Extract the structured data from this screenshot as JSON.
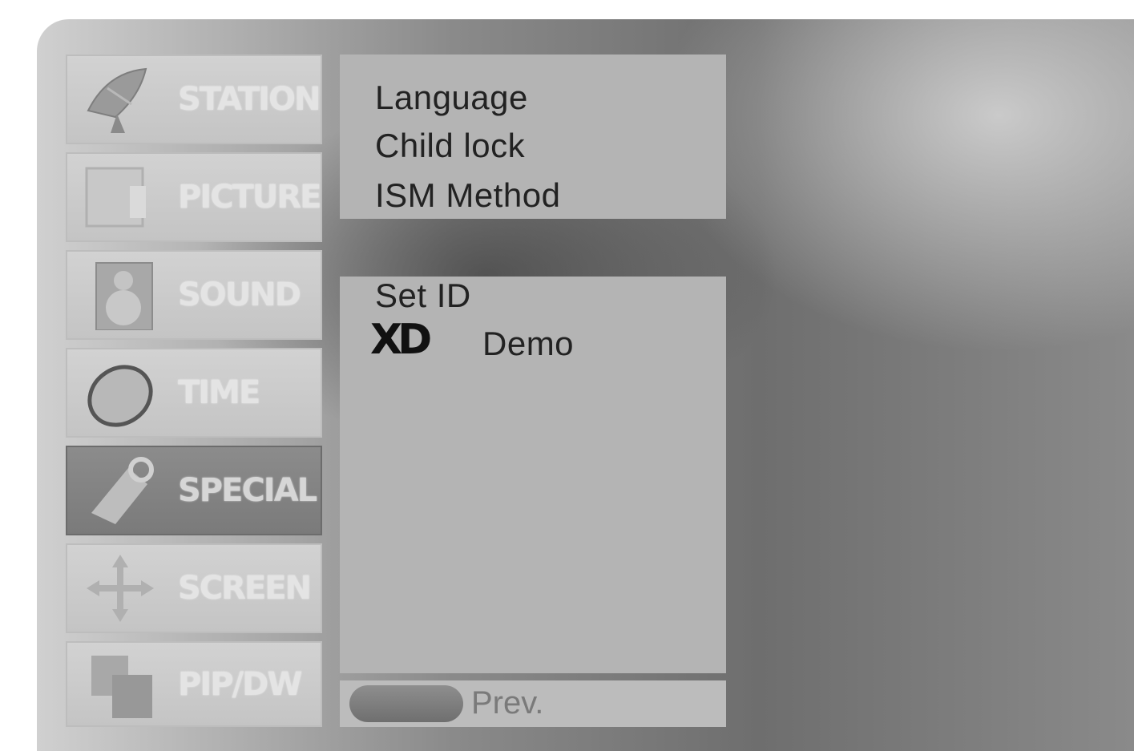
{
  "menu": {
    "items": [
      {
        "label": "STATION",
        "icon": "satellite-dish-icon",
        "active": false
      },
      {
        "label": "PICTURE",
        "icon": "tv-screen-icon",
        "active": false
      },
      {
        "label": "SOUND",
        "icon": "speaker-icon",
        "active": false
      },
      {
        "label": "TIME",
        "icon": "clock-icon",
        "active": false
      },
      {
        "label": "SPECIAL",
        "icon": "tag-icon",
        "active": true
      },
      {
        "label": "SCREEN",
        "icon": "move-arrows-icon",
        "active": false
      },
      {
        "label": "PIP/DW",
        "icon": "pip-windows-icon",
        "active": false
      }
    ]
  },
  "special_menu": {
    "top_options": [
      "Language",
      "Child lock",
      "ISM Method"
    ],
    "set_id": "Set ID",
    "xd_logo": "XD",
    "demo": "Demo"
  },
  "footer": {
    "prev_label": "Prev."
  },
  "colors": {
    "panel": "#b4b4b4",
    "active_menu": "#7a7a7a",
    "menu": "#cccccc"
  }
}
